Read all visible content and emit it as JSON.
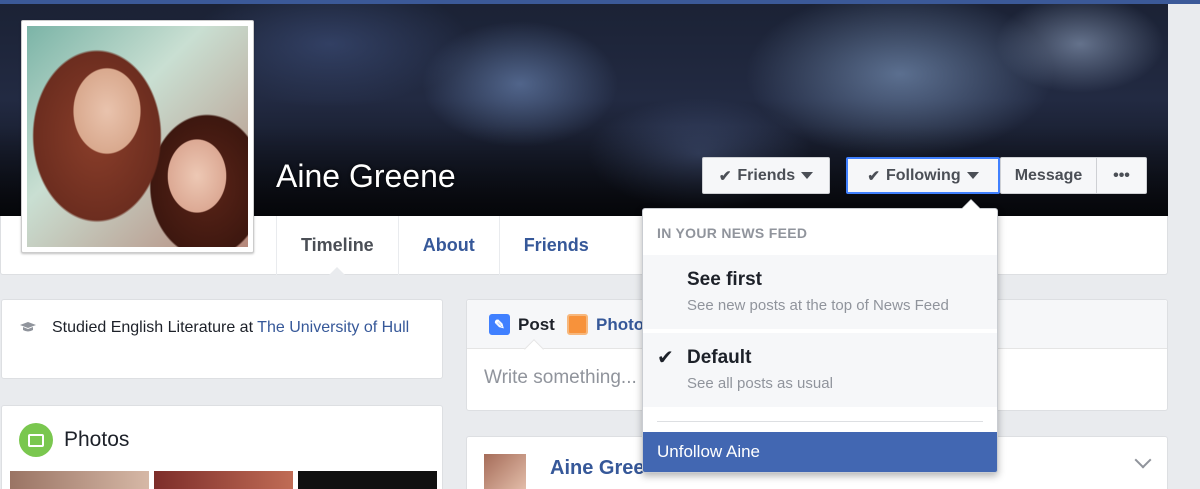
{
  "profile": {
    "name": "Aine Greene"
  },
  "actions": {
    "friends_label": "Friends",
    "following_label": "Following",
    "message_label": "Message",
    "more_label": "•••"
  },
  "tabs": [
    {
      "label": "Timeline",
      "active": true
    },
    {
      "label": "About",
      "active": false
    },
    {
      "label": "Friends",
      "active": false
    }
  ],
  "intro": {
    "prefix": "Studied English Literature at ",
    "school": "The University of Hull",
    "icon": "graduation-cap-icon"
  },
  "photos": {
    "title": "Photos",
    "icon": "photos-icon"
  },
  "composer": {
    "post_label": "Post",
    "photo_label": "Photo",
    "placeholder": "Write something..."
  },
  "feed_post": {
    "author": "Aine Gree"
  },
  "following_menu": {
    "header": "IN YOUR NEWS FEED",
    "options": [
      {
        "title": "See first",
        "subtitle": "See new posts at the top of News Feed",
        "selected": false
      },
      {
        "title": "Default",
        "subtitle": "See all posts as usual",
        "selected": true
      }
    ],
    "unfollow_label": "Unfollow Aine"
  },
  "colors": {
    "brand": "#3b5998",
    "link": "#365899",
    "highlight": "#4267b2",
    "focus_border": "#4080ff"
  }
}
